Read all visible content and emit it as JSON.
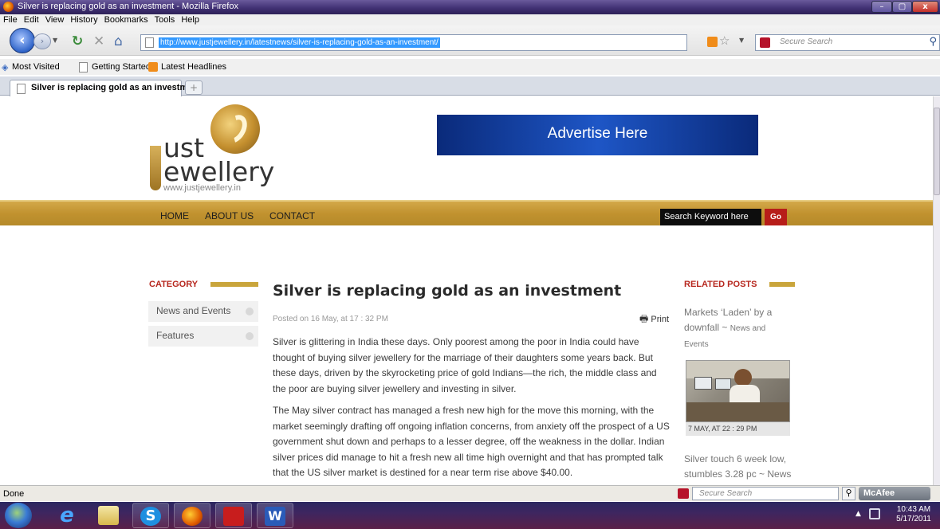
{
  "window": {
    "title": "Silver is replacing gold as an investment - Mozilla Firefox",
    "min": "–",
    "max": "▢",
    "close": "x"
  },
  "menu": [
    "File",
    "Edit",
    "View",
    "History",
    "Bookmarks",
    "Tools",
    "Help"
  ],
  "nav": {
    "url": "http://www.justjewellery.in/latestnews/silver-is-replacing-gold-as-an-investment/",
    "search_placeholder": "Secure Search"
  },
  "bookmarks": [
    "Most Visited",
    "Getting Started",
    "Latest Headlines"
  ],
  "tab": {
    "label": "Silver is replacing gold as an investm...",
    "new": "+"
  },
  "site": {
    "logo_line1": "ust",
    "logo_line2": "ewellery",
    "logo_url": "www.justjewellery.in",
    "advert": "Advertise Here",
    "nav": [
      "HOME",
      "ABOUT US",
      "CONTACT"
    ],
    "search_placeholder": "Search Keyword here",
    "go": "Go"
  },
  "category": {
    "title": "CATEGORY",
    "items": [
      "News and Events",
      "Features"
    ]
  },
  "article": {
    "title": "Silver is replacing gold as an investment",
    "posted": "Posted on 16 May, at 17 : 32 PM",
    "print": "Print",
    "p1": "Silver is glittering in India these days. Only poorest among the poor in India could have thought of buying silver jewellery for the marriage of their daughters some years back. But these days, driven by the skyrocketing price of gold Indians—the rich, the middle class and the poor are buying silver jewellery and investing in silver.",
    "p2": "The May silver contract has managed a fresh new high for the move this morning, with the market seemingly drafting off ongoing inflation concerns, from anxiety off the prospect of a US government shut down and perhaps to a lesser degree, off the weakness in the dollar. Indian silver prices did manage to hit a fresh new all time high overnight and that has prompted talk that the US silver market is destined for a near term rise above $40.00."
  },
  "related": {
    "title": "RELATED POSTS",
    "post1": {
      "line1": "Markets ‘Laden’ by a",
      "line2": "downfall ~ ",
      "line2_small": "News and",
      "line3": "Events"
    },
    "photo_caption": "7 MAY, AT 22 : 29 PM",
    "post2": {
      "line1": "Silver touch 6 week low,",
      "line2": "stumbles 3.28 pc ~ ",
      "line2_small": "News"
    }
  },
  "status": {
    "text": "Done",
    "search_placeholder": "Secure Search",
    "mcafee": "McAfee"
  },
  "taskbar": {
    "time": "10:43 AM",
    "date": "5/17/2011"
  }
}
